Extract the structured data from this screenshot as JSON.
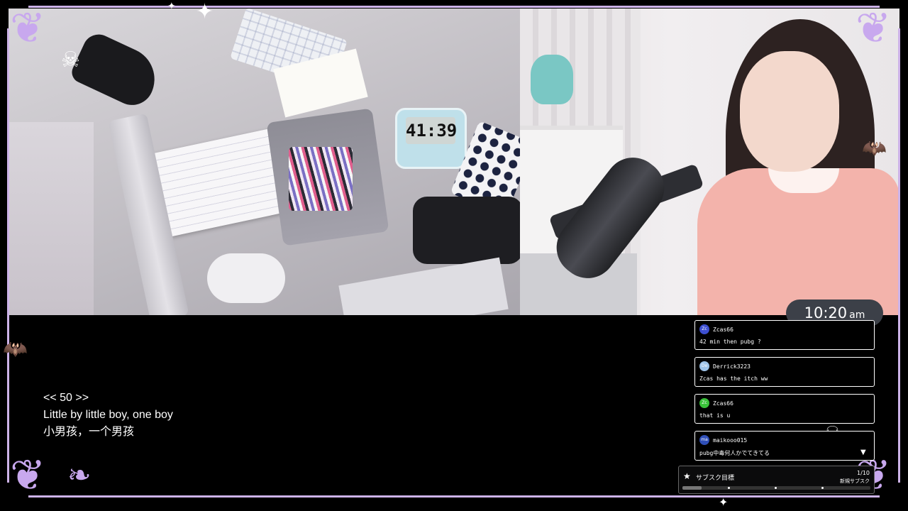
{
  "timer_display": "41:39",
  "subtitle": {
    "index_line": "<< 50 >>",
    "english": "Little by little boy, one boy",
    "chinese": "小男孩，一个男孩"
  },
  "clock": {
    "time": "10:20",
    "ampm": "am"
  },
  "chat": {
    "messages": [
      {
        "avatar_text": "Zc",
        "avatar_color": "#3d4fd0",
        "user": "Zcas66",
        "text": "42 min then pubg ?"
      },
      {
        "avatar_text": "De",
        "avatar_color": "#9ec3e8",
        "user": "Derrick3223",
        "text": "Zcas has the itch ww"
      },
      {
        "avatar_text": "Zc",
        "avatar_color": "#3ac23a",
        "user": "Zcas66",
        "text": "that is u"
      },
      {
        "avatar_text": "ma",
        "avatar_color": "#2f4fb8",
        "user": "maikooo015",
        "text": "pubg中毒何人かでてきてる"
      }
    ]
  },
  "sub_goal": {
    "title": "サブスク目標",
    "count": "1/10",
    "subtitle": "新規サブスク",
    "progress": 0.1
  },
  "colors": {
    "frame": "#cdb3e8",
    "clock_bg": "#3c4048"
  }
}
